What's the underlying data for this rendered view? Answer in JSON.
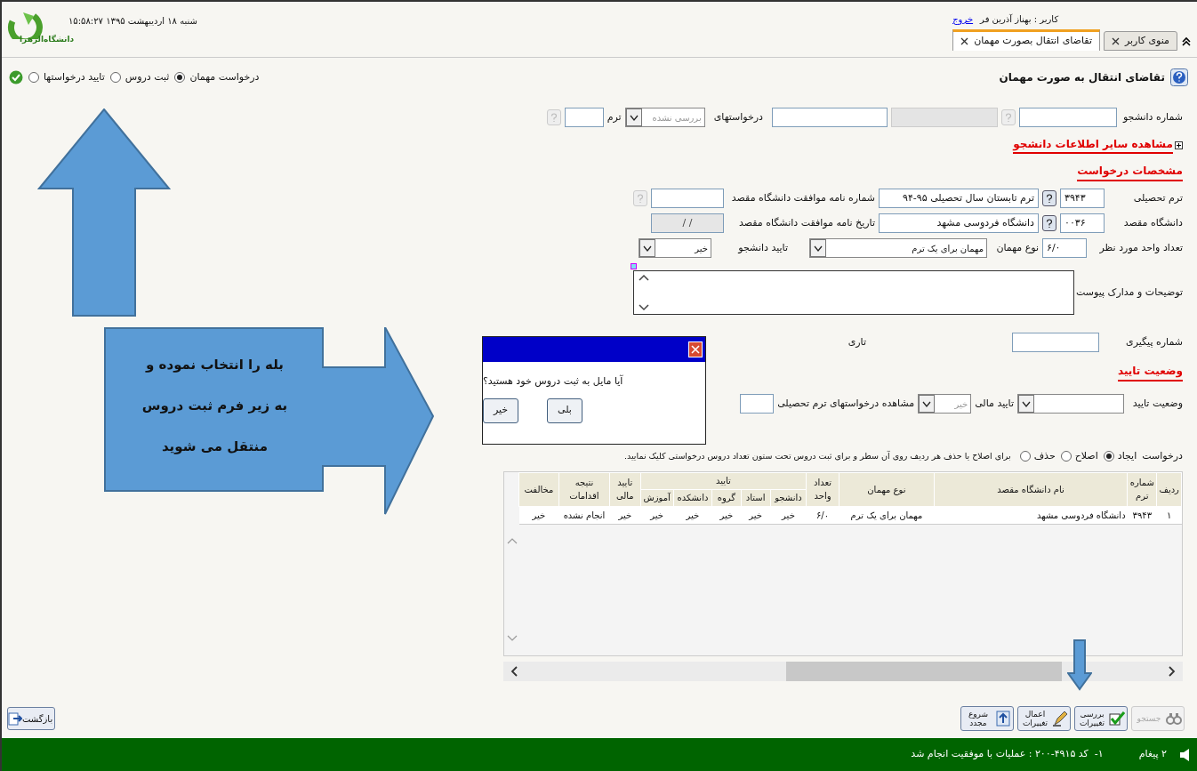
{
  "header": {
    "logo_text": "دانشگاه‌الزهرا",
    "datetime": "۱۵:۵۸:۲۷ شنبه ۱۸ اردیبهشت ۱۳۹۵",
    "user": "کاربر : بهناز آذرین فر",
    "logout": "خروج"
  },
  "tabs": [
    {
      "label": "منوی کاربر",
      "selected": false
    },
    {
      "label": "تقاضای انتقال بصورت مهمان",
      "selected": true
    }
  ],
  "steps": [
    {
      "label": "درخواست مهمان",
      "selected": true
    },
    {
      "label": "ثبت دروس",
      "selected": false
    },
    {
      "label": "تایید درخواستها",
      "selected": false
    }
  ],
  "page_title": "تقاضای انتقال به صورت مهمان",
  "search_row": {
    "student_label": "شماره دانشجو",
    "requests_label": "درخواستهای",
    "status": {
      "value": "بررسی نشده",
      "disabled": true
    },
    "term_label": "ترم"
  },
  "more_info_link": "مشاهده سایر اطلاعات دانشجو",
  "request": {
    "heading": "مشخصات درخواست",
    "term": {
      "label": "ترم تحصیلی",
      "code": "۳۹۴۳",
      "name": "ترم تابستان سال تحصیلی ۹۵-۹۴"
    },
    "letter_number": {
      "label": "شماره نامه موافقت دانشگاه مقصد"
    },
    "university": {
      "label": "دانشگاه مقصد",
      "code": "۰۰۳۶",
      "name": "دانشگاه فردوسی مشهد"
    },
    "letter_date": {
      "label": "تاریخ نامه موافقت دانشگاه مقصد",
      "value": "/     /",
      "disabled": true
    },
    "units": {
      "label": "تعداد واحد مورد نظر",
      "value": "۶/۰"
    },
    "guest_type": {
      "label": "نوع مهمان",
      "value": "مهمان برای یک ترم",
      "disabled": false
    },
    "student_approval": {
      "label": "تایید دانشجو",
      "value": "خیر",
      "disabled": false
    },
    "notes": {
      "label": "توضیحات و مدارک پیوست"
    },
    "tracking": {
      "label": "شماره پیگیری"
    },
    "date_label": "تاری"
  },
  "approval": {
    "heading": "وضعیت تایید",
    "status_label": "وضعیت تایید",
    "finance_label": "تایید مالی",
    "finance": {
      "value": "خیر",
      "disabled": true
    },
    "term_requests_label": "مشاهده درخواستهای ترم تحصیلی"
  },
  "mode": {
    "label": "درخواست",
    "options": [
      {
        "label": "ایجاد",
        "selected": true
      },
      {
        "label": "اصلاح",
        "selected": false
      },
      {
        "label": "حذف",
        "selected": false
      }
    ],
    "hint": "برای اصلاح یا حذف هر ردیف روی آن سطر و برای ثبت دروس تحت ستون تعداد دروس درخواستی کلیک نمایید."
  },
  "table": {
    "columns": [
      {
        "label": "ردیف"
      },
      {
        "label": "شماره ترم"
      },
      {
        "label": "نام دانشگاه مقصد"
      },
      {
        "label": "نوع مهمان"
      },
      {
        "label": "تعداد واحد"
      },
      {
        "label": "دانشجو",
        "in_group": true
      },
      {
        "label": "استاد",
        "in_group": true
      },
      {
        "label": "گروه",
        "in_group": true
      },
      {
        "label": "دانشکده",
        "in_group": true
      },
      {
        "label": "آموزش",
        "in_group": true
      },
      {
        "label": "تایید مالی"
      },
      {
        "label": "نتیجه اقدامات"
      },
      {
        "label": "مخالفت"
      }
    ],
    "column_group": "تایید",
    "rows": [
      [
        "۱",
        "۳۹۴۳",
        "دانشگاه فردوسی مشهد",
        "مهمان برای یک ترم",
        "۶/۰",
        "خیر",
        "خیر",
        "خیر",
        "خیر",
        "خیر",
        "خیر",
        "انجام نشده",
        "خیر"
      ]
    ]
  },
  "dialog": {
    "message": "آیا مایل به ثبت دروس خود هستید؟",
    "buttons": [
      "بلی",
      "خیر"
    ]
  },
  "annotation": "بله را انتخاب نموده و\nبه زیر فرم ثبت دروس\nمنتقل می شوید",
  "toolbar": [
    {
      "label": "جستجو",
      "disabled": true,
      "kind": "search"
    },
    {
      "label": "بررسی تغییرات",
      "disabled": false,
      "kind": "check"
    },
    {
      "label": "اعمال تغییرات",
      "disabled": false,
      "kind": "apply"
    },
    {
      "label": "شروع مجدد",
      "disabled": false,
      "kind": "restart"
    }
  ],
  "back_button": "بازگشت",
  "status_bar": {
    "messages": "۲ پیغام",
    "text": "۱-  کد ۴۹۱۵-۲۰۰ : عملیات با موفقیت انجام شد"
  }
}
